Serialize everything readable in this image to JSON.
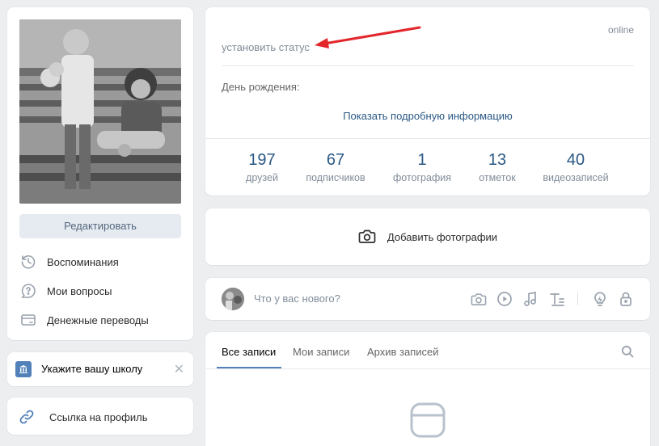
{
  "left": {
    "edit_label": "Редактировать",
    "menu": [
      {
        "label": "Воспоминания",
        "icon": "clock-history-icon"
      },
      {
        "label": "Мои вопросы",
        "icon": "question-bubble-icon"
      },
      {
        "label": "Денежные переводы",
        "icon": "card-transfer-icon"
      }
    ],
    "school_label": "Укажите вашу школу",
    "profile_link_label": "Ссылка на профиль"
  },
  "profile": {
    "online": "online",
    "status_placeholder": "установить статус",
    "birthday_label": "День рождения:",
    "more_info": "Показать подробную информацию",
    "counters": [
      {
        "value": "197",
        "label": "друзей"
      },
      {
        "value": "67",
        "label": "подписчиков"
      },
      {
        "value": "1",
        "label": "фотография"
      },
      {
        "value": "13",
        "label": "отметок"
      },
      {
        "value": "40",
        "label": "видеозаписей"
      }
    ]
  },
  "photos": {
    "add_label": "Добавить фотографии"
  },
  "post": {
    "placeholder": "Что у вас нового?",
    "icons": [
      "camera-icon",
      "play-icon",
      "music-note-icon",
      "text-format-icon",
      "lightbulb-icon",
      "lock-icon"
    ]
  },
  "wall": {
    "tabs": [
      "Все записи",
      "Мои записи",
      "Архив записей"
    ]
  },
  "colors": {
    "accent": "#5181b8",
    "link": "#2a5885",
    "muted": "#818c99",
    "arrow": "#e3262b"
  }
}
